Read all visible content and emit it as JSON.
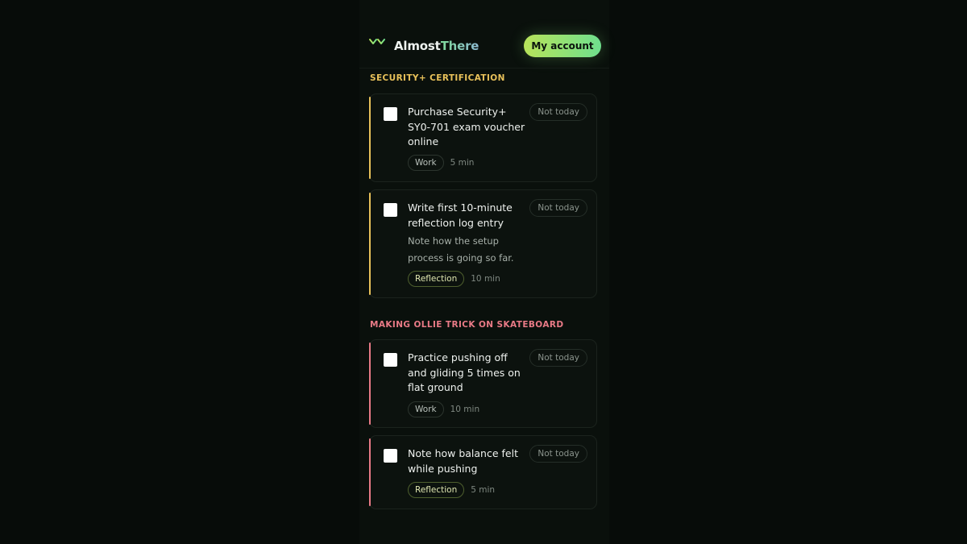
{
  "header": {
    "brand_part1": "Almost",
    "brand_part2": "There",
    "account_button": "My account"
  },
  "colors": {
    "background": "#070c09",
    "security_accent": "#e8c15a",
    "skateboard_accent": "#e87a86",
    "brand_gradient_start": "#b7e35a",
    "brand_gradient_end": "#6fe08e"
  },
  "sections": [
    {
      "title": "SECURITY+ CERTIFICATION",
      "tasks": [
        {
          "title": "Purchase Security+ SY0-701 exam voucher online",
          "note": "",
          "tag": "Work",
          "duration": "5 min",
          "action": "Not today",
          "done": false
        },
        {
          "title": "Write first 10-minute reflection log entry",
          "note": "Note how the setup process is going so far.",
          "tag": "Reflection",
          "duration": "10 min",
          "action": "Not today",
          "done": false
        }
      ]
    },
    {
      "title": "MAKING OLLIE TRICK ON SKATEBOARD",
      "tasks": [
        {
          "title": "Practice pushing off and gliding 5 times on flat ground",
          "note": "",
          "tag": "Work",
          "duration": "10 min",
          "action": "Not today",
          "done": false
        },
        {
          "title": "Note how balance felt while pushing",
          "note": "",
          "tag": "Reflection",
          "duration": "5 min",
          "action": "Not today",
          "done": false
        }
      ]
    }
  ],
  "icons": {
    "logo": "sprout-icon"
  }
}
